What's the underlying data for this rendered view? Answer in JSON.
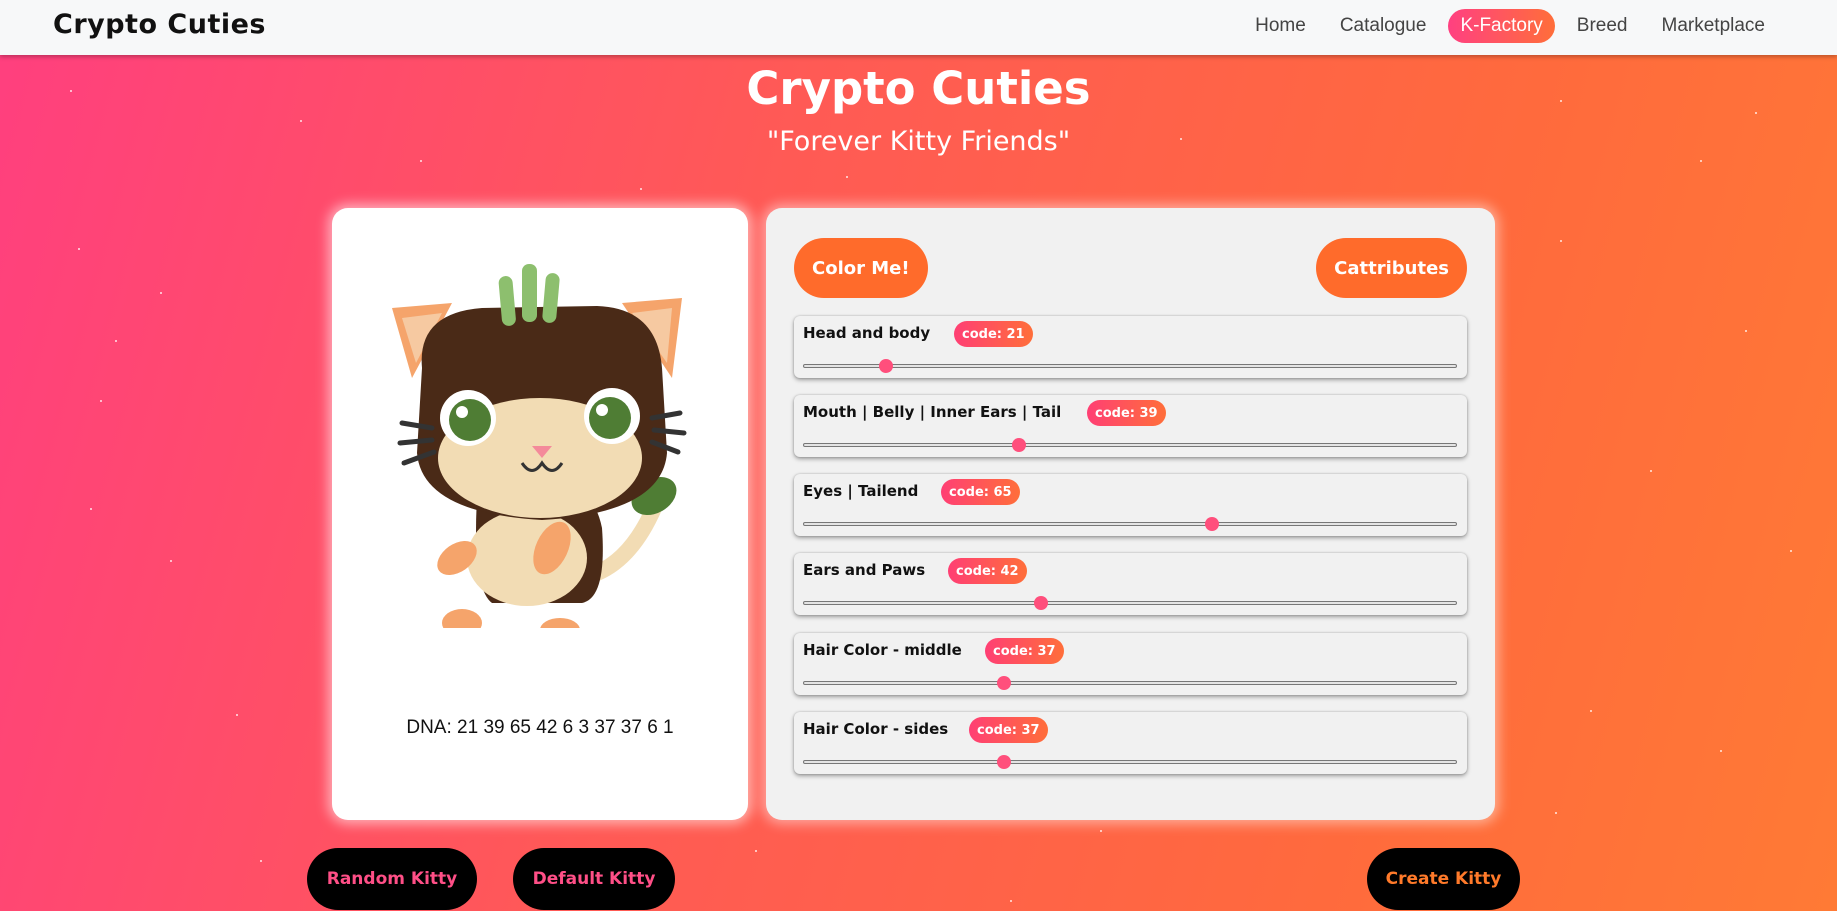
{
  "navbar": {
    "brand": "Crypto Cuties",
    "links": [
      "Home",
      "Catalogue",
      "K-Factory",
      "Breed",
      "Marketplace"
    ],
    "active": "K-Factory"
  },
  "hero": {
    "title": "Crypto Cuties",
    "subtitle": "\"Forever Kitty Friends\""
  },
  "cat": {
    "dna_text": "DNA: 21 39 65 42 6 3 37 37 6 1",
    "colors": {
      "body": "#4a2a17",
      "ears_outer": "#f5a46b",
      "ears_inner": "#f6c9a1",
      "face": "#f2dcb4",
      "eyes": "#4f7d34",
      "hair_middle": "#8dbf6e",
      "tail_tip": "#4f7d34",
      "paws": "#f5a46b"
    }
  },
  "panel": {
    "color_button": "Color Me!",
    "cattributes_button": "Cattributes",
    "attributes": [
      {
        "label": "Head and body",
        "code": "code: 21",
        "value": 21
      },
      {
        "label": "Mouth | Belly | Inner Ears | Tail",
        "code": "code: 39",
        "value": 39
      },
      {
        "label": "Eyes | Tailend",
        "code": "code: 65",
        "value": 65
      },
      {
        "label": "Ears and Paws",
        "code": "code: 42",
        "value": 42
      },
      {
        "label": "Hair Color - middle",
        "code": "code: 37",
        "value": 37
      },
      {
        "label": "Hair Color - sides",
        "code": "code: 37",
        "value": 37
      }
    ]
  },
  "actions": {
    "random": "Random Kitty",
    "default": "Default Kitty",
    "create": "Create Kitty"
  }
}
